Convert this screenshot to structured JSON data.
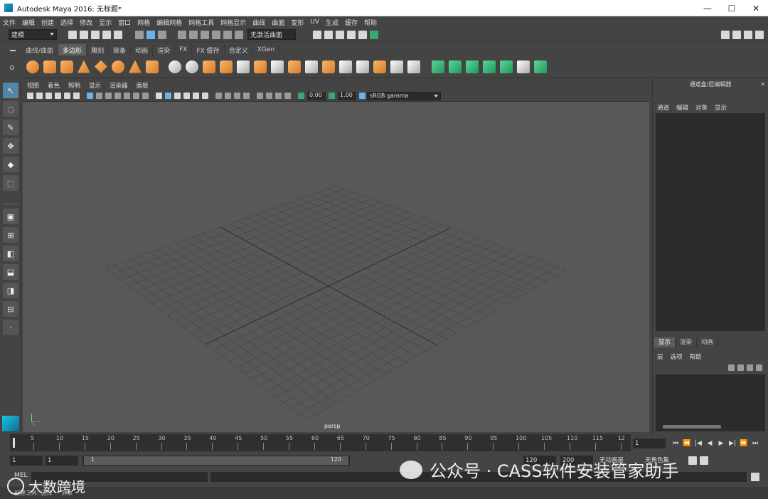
{
  "window": {
    "title": "Autodesk Maya 2016: 无标题*",
    "min_symbol": "—",
    "max_symbol": "☐",
    "close_symbol": "✕"
  },
  "menubar": [
    "文件",
    "编辑",
    "创建",
    "选择",
    "修改",
    "显示",
    "窗口",
    "网格",
    "编辑网格",
    "网格工具",
    "网格显示",
    "曲线",
    "曲面",
    "变形",
    "UV",
    "生成",
    "缓存",
    "帮助"
  ],
  "statusline": {
    "mode": "建模",
    "live_surface": "无激活曲面"
  },
  "shelf": {
    "tabs": [
      "曲线/曲面",
      "多边形",
      "雕刻",
      "装备",
      "动画",
      "渲染",
      "FX",
      "FX 缓存",
      "自定义",
      "XGen"
    ],
    "active_tab": "多边形"
  },
  "panel": {
    "menu": [
      "视图",
      "着色",
      "照明",
      "显示",
      "渲染器",
      "面板"
    ],
    "exposure": "0.00",
    "gamma": "1.00",
    "colorspace": "sRGB gamma",
    "camera_label": "persp"
  },
  "channelbox": {
    "title": "通道盒/层编辑器",
    "menu": [
      "通道",
      "编辑",
      "对象",
      "显示"
    ],
    "layer_tabs": [
      "显示",
      "渲染",
      "动画"
    ],
    "layer_menu": [
      "层",
      "选项",
      "帮助"
    ]
  },
  "timeline": {
    "ticks": [
      "5",
      "10",
      "15",
      "20",
      "25",
      "30",
      "35",
      "40",
      "45",
      "50",
      "55",
      "60",
      "65",
      "70",
      "75",
      "80",
      "85",
      "90",
      "95",
      "100",
      "105",
      "110",
      "115",
      "12"
    ],
    "current_frame": "1",
    "playback_symbols": [
      "⏮",
      "⏪",
      "|◀",
      "◀",
      "▶",
      "▶|",
      "⏩",
      "⏭"
    ]
  },
  "range": {
    "start": "1",
    "playback_start": "1",
    "slider_start": "1",
    "slider_end": "120",
    "playback_end": "120",
    "end": "200",
    "anim_layer": "无动画层",
    "char_set": "无角色集"
  },
  "cmdline": {
    "lang": "MEL"
  },
  "helpline": {
    "text": "创建工具: 选择 一 对象"
  },
  "watermark": {
    "left": "大数跨境",
    "right": "公众号 · CASS软件安装管家助手"
  },
  "colors": {
    "ui_bg": "#444444",
    "viewport_bg": "#585858",
    "grid_line": "#4a4a4a",
    "grid_axis": "#333333",
    "selected": "#5285a6",
    "accent_green": "#3aa96b"
  }
}
